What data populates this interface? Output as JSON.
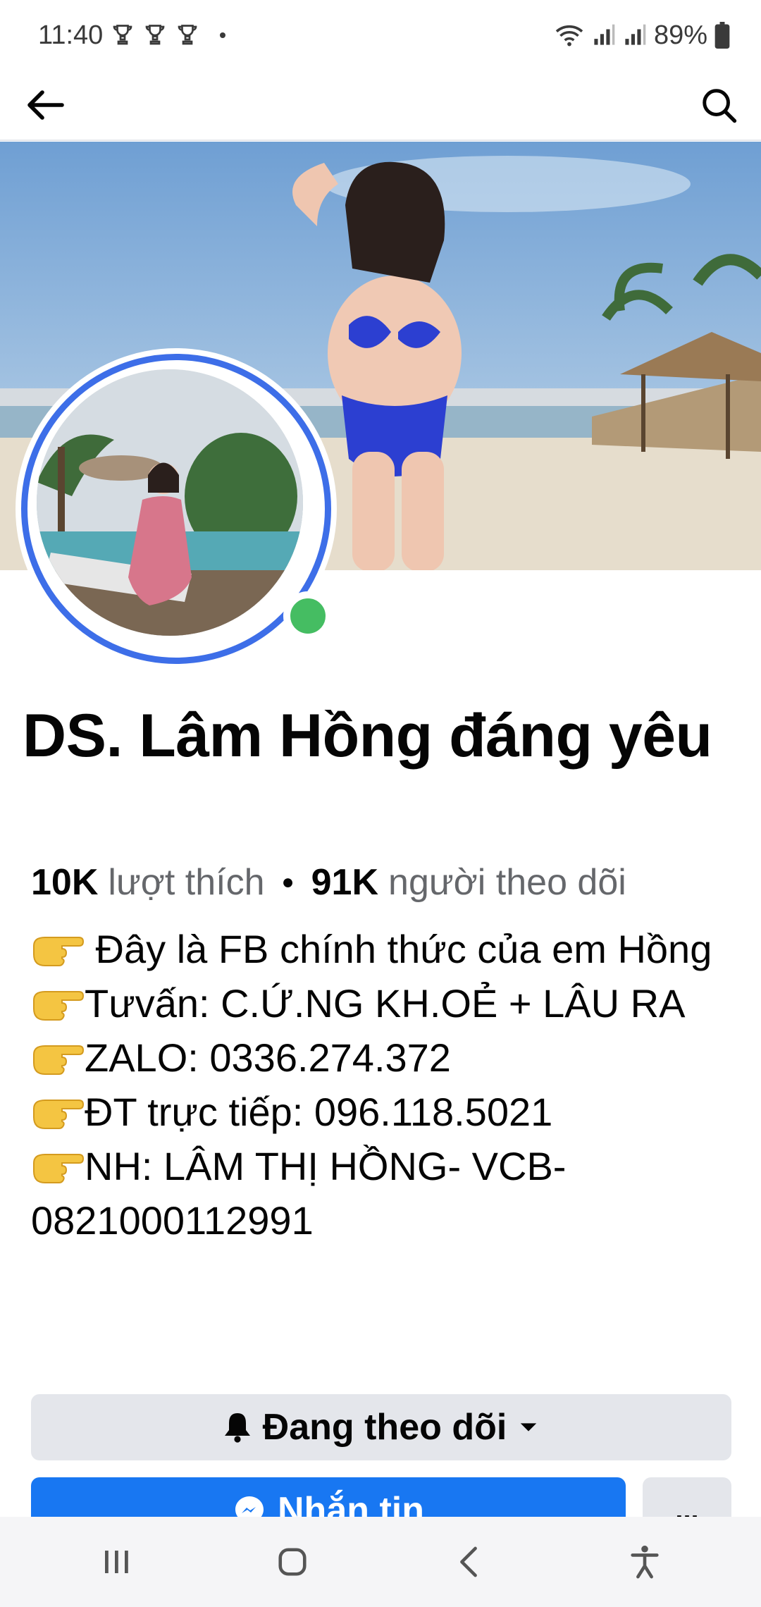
{
  "status_bar": {
    "time": "11:40",
    "notification_icons": [
      "trophy-icon",
      "trophy-icon",
      "trophy-icon"
    ],
    "battery": "89%",
    "icons": [
      "wifi-icon",
      "signal-icon",
      "signal-icon",
      "battery-icon"
    ]
  },
  "app_bar": {
    "back_icon": "arrow-left-icon",
    "search_icon": "search-icon"
  },
  "profile": {
    "title": "DS. Lâm Hồng đáng yêu",
    "likes_count": "10K",
    "likes_label": "lượt thích",
    "followers_count": "91K",
    "followers_label": "người theo dõi",
    "online": true
  },
  "bio": {
    "line1": " Đây là FB chính thức của em Hồng",
    "line2": "Tưvấn: C.Ứ.NG KH.OẺ + LÂU RA",
    "line3": "ZALO: 0336.274.372",
    "line4": "ĐT trực tiếp: 096.118.5021",
    "line5": "NH: LÂM THỊ HỒNG- VCB-0821000112991"
  },
  "actions": {
    "following_label": "Đang theo dõi",
    "message_label": "Nhắn tin",
    "more_label": "..."
  },
  "colors": {
    "accent": "#1877f2",
    "avatar_ring": "#3d6ee8",
    "online": "#45bd62",
    "secondary_text": "#65676b",
    "button_gray": "#e4e6eb"
  },
  "nav_bar": {
    "icons": [
      "recent-apps-icon",
      "home-icon",
      "back-icon",
      "accessibility-icon"
    ]
  }
}
